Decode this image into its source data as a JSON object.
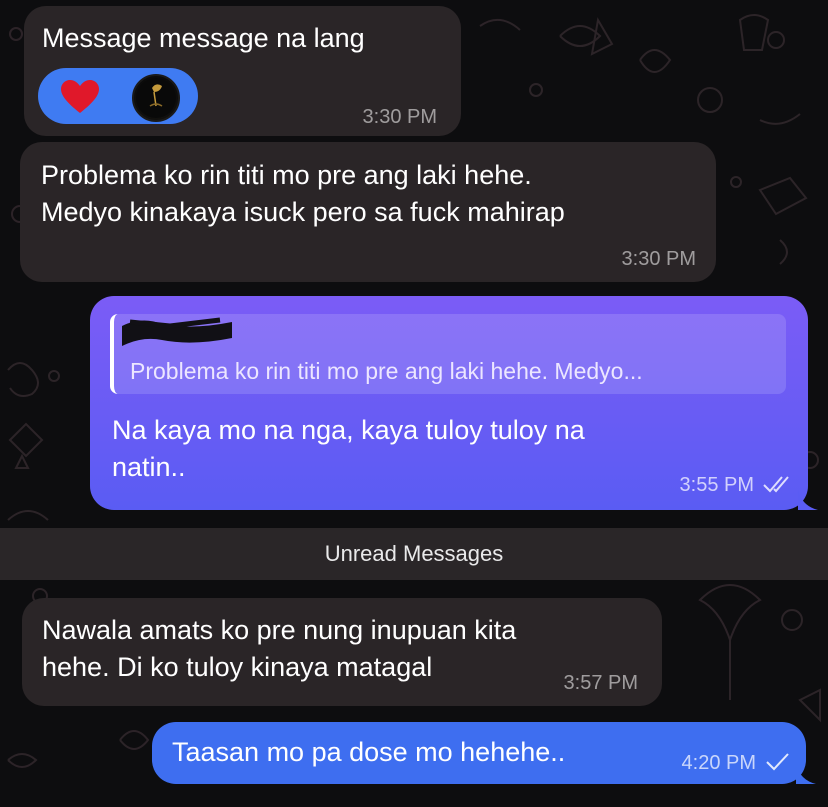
{
  "chat": {
    "messages": [
      {
        "text": "Message message na lang",
        "time": "3:30 PM",
        "direction": "incoming",
        "reactions": [
          "heart",
          "avatar"
        ]
      },
      {
        "text": "Problema ko rin titi mo pre ang laki hehe.\nMedyo kinakaya isuck pero sa fuck mahirap",
        "time": "3:30 PM",
        "direction": "incoming"
      },
      {
        "reply_preview": "Problema ko rin titi mo pre ang laki hehe. Medyo...",
        "text": "Na kaya mo na nga, kaya tuloy tuloy na\nnatin..",
        "time": "3:55 PM",
        "direction": "outgoing",
        "status": "read"
      },
      {
        "text": "Nawala amats ko pre nung inupuan kita\nhehe. Di ko tuloy kinaya matagal",
        "time": "3:57 PM",
        "direction": "incoming"
      },
      {
        "text": "Taasan mo pa dose mo hehehe..",
        "time": "4:20 PM",
        "direction": "outgoing",
        "status": "sent"
      }
    ],
    "unread_divider": "Unread Messages"
  },
  "colors": {
    "background": "#0d0d0f",
    "incoming_bubble": "#2a2527",
    "outgoing_bubble_gradient": [
      "#7b5cf6",
      "#5a5cf3"
    ],
    "outgoing_bubble_blue": "#3e6ef0",
    "reaction_pill": "#3f7bf2",
    "heart": "#e0182a"
  },
  "icons": {
    "reaction_heart": "heart-icon",
    "read_receipt": "double-check-icon",
    "sent_receipt": "check-icon"
  }
}
